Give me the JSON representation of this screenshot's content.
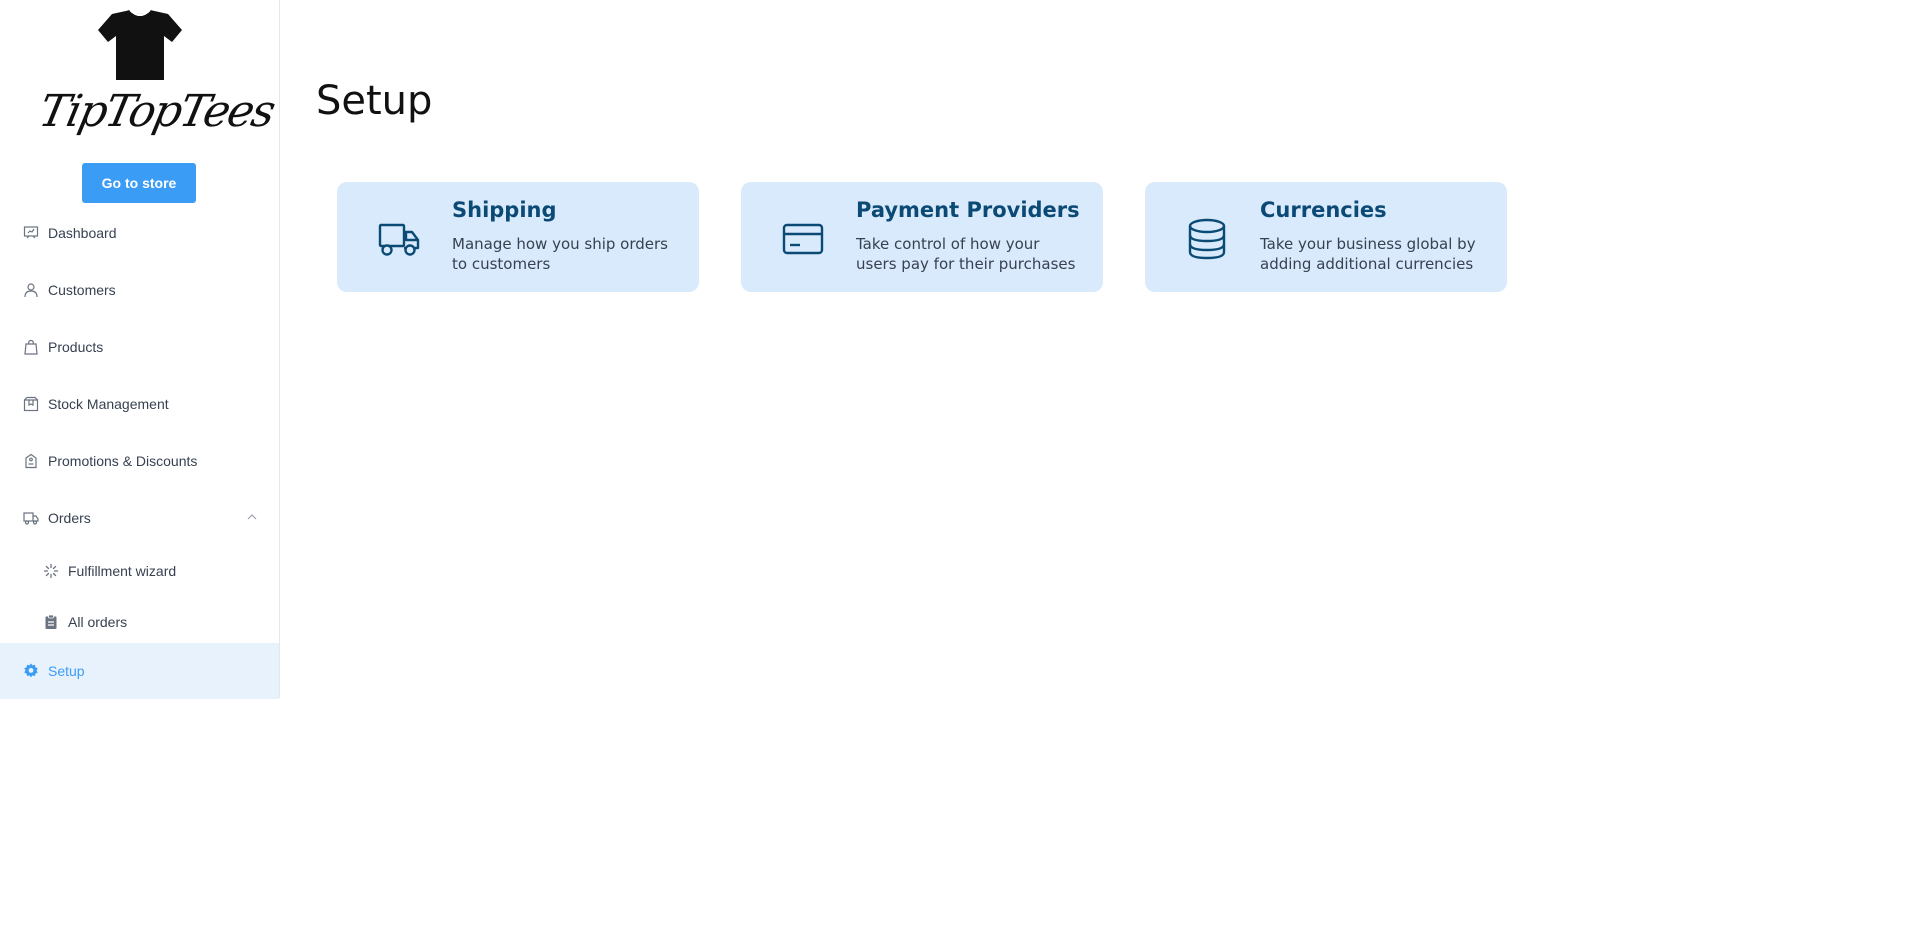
{
  "brand": {
    "logo_text": "TipTopTees"
  },
  "sidebar": {
    "store_button": "Go to store",
    "items": [
      {
        "label": "Dashboard",
        "icon": "presentation-chart-icon"
      },
      {
        "label": "Customers",
        "icon": "user-icon"
      },
      {
        "label": "Products",
        "icon": "shopping-bag-icon"
      },
      {
        "label": "Stock Management",
        "icon": "box-icon"
      },
      {
        "label": "Promotions & Discounts",
        "icon": "tag-icon"
      },
      {
        "label": "Orders",
        "icon": "truck-icon",
        "expanded": true
      },
      {
        "label": "Fulfillment wizard",
        "icon": "spinner-icon"
      },
      {
        "label": "All orders",
        "icon": "clipboard-icon"
      },
      {
        "label": "Setup",
        "icon": "gear-icon",
        "active": true
      }
    ]
  },
  "main": {
    "title": "Setup",
    "cards": [
      {
        "title": "Shipping",
        "description": "Manage how you ship orders to customers",
        "icon": "truck-icon"
      },
      {
        "title": "Payment Providers",
        "description": "Take control of how your users pay for their purchases",
        "icon": "credit-card-icon"
      },
      {
        "title": "Currencies",
        "description": "Take your business global by adding additional currencies",
        "icon": "database-icon"
      }
    ]
  },
  "colors": {
    "accent": "#3b9cf5",
    "card_bg": "#d9eafc",
    "card_title": "#0b4a75",
    "active_bg": "#e8f2fd"
  }
}
